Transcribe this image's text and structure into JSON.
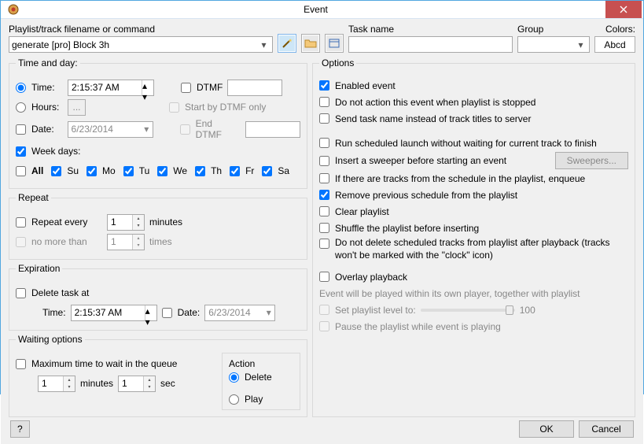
{
  "window": {
    "title": "Event"
  },
  "top": {
    "filename_label": "Playlist/track filename or command",
    "filename_value": "generate [pro] Block 3h",
    "taskname_label": "Task name",
    "taskname_value": "",
    "group_label": "Group",
    "group_value": "",
    "colors_label": "Colors:",
    "colors_sample": "Abcd"
  },
  "timeday": {
    "legend": "Time and day:",
    "time_label": "Time:",
    "time_value": "2:15:37 AM",
    "hours_label": "Hours:",
    "hours_btn": "...",
    "date_label": "Date:",
    "date_value": "6/23/2014",
    "dtmf_label": "DTMF",
    "dtmf_value": "",
    "start_dtmf_label": "Start by DTMF only",
    "end_dtmf_label": "End DTMF",
    "end_dtmf_value": "",
    "weekdays_label": "Week days:",
    "all_label": "All",
    "days": [
      "Su",
      "Mo",
      "Tu",
      "We",
      "Th",
      "Fr",
      "Sa"
    ]
  },
  "repeat": {
    "legend": "Repeat",
    "every_label": "Repeat every",
    "every_value": "1",
    "every_unit": "minutes",
    "nomore_label": "no more than",
    "nomore_value": "1",
    "nomore_unit": "times"
  },
  "expiration": {
    "legend": "Expiration",
    "delete_at_label": "Delete task at",
    "time_label": "Time:",
    "time_value": "2:15:37 AM",
    "date_label": "Date:",
    "date_value": "6/23/2014"
  },
  "waiting": {
    "legend": "Waiting options",
    "max_label": "Maximum time to wait in the queue",
    "min_value": "1",
    "min_unit": "minutes",
    "sec_value": "1",
    "sec_unit": "sec",
    "action_label": "Action",
    "action_delete": "Delete",
    "action_play": "Play"
  },
  "options": {
    "legend": "Options",
    "enabled": "Enabled event",
    "noaction_stopped": "Do not action this event when playlist is stopped",
    "send_taskname": "Send task name instead of track titles to server",
    "run_nowait": "Run scheduled launch without waiting for current track to finish",
    "insert_sweeper": "Insert a sweeper before starting an event",
    "sweepers_btn": "Sweepers...",
    "enqueue_if_tracks": "If there are tracks from the schedule in the playlist, enqueue",
    "remove_prev": "Remove previous schedule from the playlist",
    "clear_playlist": "Clear playlist",
    "shuffle": "Shuffle the playlist before inserting",
    "no_delete_clock": "Do not delete scheduled tracks from playlist after playback (tracks won't be marked with the \"clock\" icon)",
    "overlay_label": "Overlay playback",
    "overlay_hint": "Event will be played within its own player, together with playlist",
    "set_level_label": "Set playlist level to:",
    "set_level_value": "100",
    "pause_playlist": "Pause the playlist while event is playing"
  },
  "footer": {
    "help": "?",
    "ok": "OK",
    "cancel": "Cancel"
  }
}
